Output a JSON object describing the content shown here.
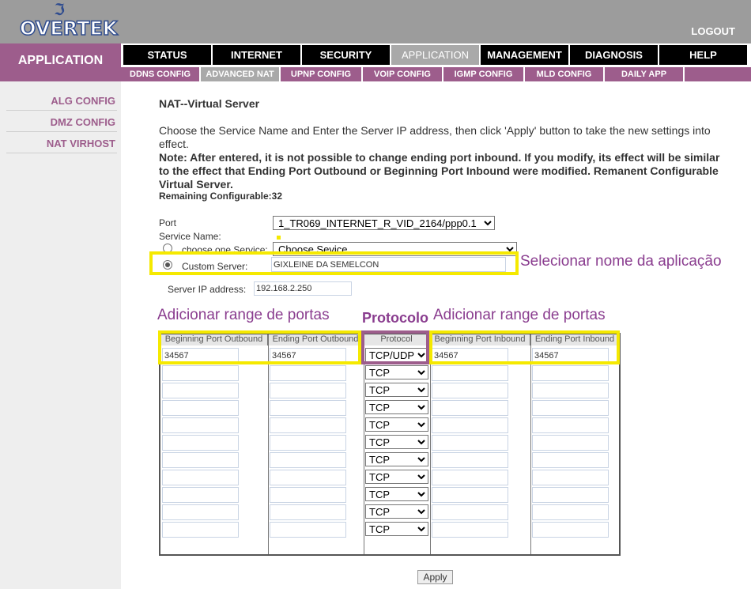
{
  "header": {
    "logo_text": "OVERTEK",
    "logout": "LOGOUT"
  },
  "section_label": "APPLICATION",
  "main_tabs": [
    {
      "label": "STATUS"
    },
    {
      "label": "INTERNET"
    },
    {
      "label": "SECURITY"
    },
    {
      "label": "APPLICATION",
      "active": true
    },
    {
      "label": "MANAGEMENT"
    },
    {
      "label": "DIAGNOSIS"
    },
    {
      "label": "HELP"
    }
  ],
  "sub_tabs": [
    {
      "label": "DDNS CONFIG"
    },
    {
      "label": "ADVANCED NAT",
      "active": true
    },
    {
      "label": "UPNP CONFIG"
    },
    {
      "label": "VOIP CONFIG"
    },
    {
      "label": "IGMP CONFIG"
    },
    {
      "label": "MLD CONFIG"
    },
    {
      "label": "DAILY APP"
    }
  ],
  "sidebar": {
    "items": [
      {
        "label": "ALG CONFIG"
      },
      {
        "label": "DMZ CONFIG"
      },
      {
        "label": "NAT VIRHOST"
      }
    ]
  },
  "page": {
    "title": "NAT--Virtual Server",
    "intro": "Choose the Service Name and Enter the Server IP address, then click 'Apply' button to take the new settings into effect.",
    "note": "Note: After entered, it is not possible to change ending port inbound. If you modify, its effect will be similar to the effect that Ending Port Outbound or Beginning Port Inbound were modified. Remanent Configurable Virtual Server.",
    "remaining": "Remaining Configurable:32"
  },
  "form": {
    "port_label": "Port",
    "port_value": "1_TR069_INTERNET_R_VID_2164/ppp0.1",
    "service_name_label": "Service Name:",
    "choose_service_label": "choose one Service:",
    "choose_service_value": "Choose Sevice",
    "custom_server_label": "Custom Server:",
    "custom_server_value": "GIXLEINE DA SEMELCON",
    "server_ip_label": "Server IP address:",
    "server_ip_value": "192.168.2.250"
  },
  "annotations": {
    "select_app_name": "Selecionar nome da aplicação",
    "add_port_range_left": "Adicionar range de portas",
    "protocol": "Protocolo",
    "add_port_range_right": "Adicionar range de portas"
  },
  "ports_table": {
    "headers": [
      "Beginning Port Outbound",
      "Ending Port Outbound",
      "Protocol",
      "Beginning Port Inbound",
      "Ending Port Inbound"
    ],
    "rows": [
      {
        "begin_out": "34567",
        "end_out": "34567",
        "protocol": "TCP/UDP",
        "begin_in": "34567",
        "end_in": "34567"
      },
      {
        "begin_out": "",
        "end_out": "",
        "protocol": "TCP",
        "begin_in": "",
        "end_in": ""
      },
      {
        "begin_out": "",
        "end_out": "",
        "protocol": "TCP",
        "begin_in": "",
        "end_in": ""
      },
      {
        "begin_out": "",
        "end_out": "",
        "protocol": "TCP",
        "begin_in": "",
        "end_in": ""
      },
      {
        "begin_out": "",
        "end_out": "",
        "protocol": "TCP",
        "begin_in": "",
        "end_in": ""
      },
      {
        "begin_out": "",
        "end_out": "",
        "protocol": "TCP",
        "begin_in": "",
        "end_in": ""
      },
      {
        "begin_out": "",
        "end_out": "",
        "protocol": "TCP",
        "begin_in": "",
        "end_in": ""
      },
      {
        "begin_out": "",
        "end_out": "",
        "protocol": "TCP",
        "begin_in": "",
        "end_in": ""
      },
      {
        "begin_out": "",
        "end_out": "",
        "protocol": "TCP",
        "begin_in": "",
        "end_in": ""
      },
      {
        "begin_out": "",
        "end_out": "",
        "protocol": "TCP",
        "begin_in": "",
        "end_in": ""
      },
      {
        "begin_out": "",
        "end_out": "",
        "protocol": "TCP",
        "begin_in": "",
        "end_in": ""
      }
    ]
  },
  "apply_label": "Apply",
  "colors": {
    "brand_purple": "#9d5d8c",
    "highlight_yellow": "#f5e900",
    "annotation_purple": "#8a3d8f",
    "header_gray": "#9c9c9c"
  }
}
